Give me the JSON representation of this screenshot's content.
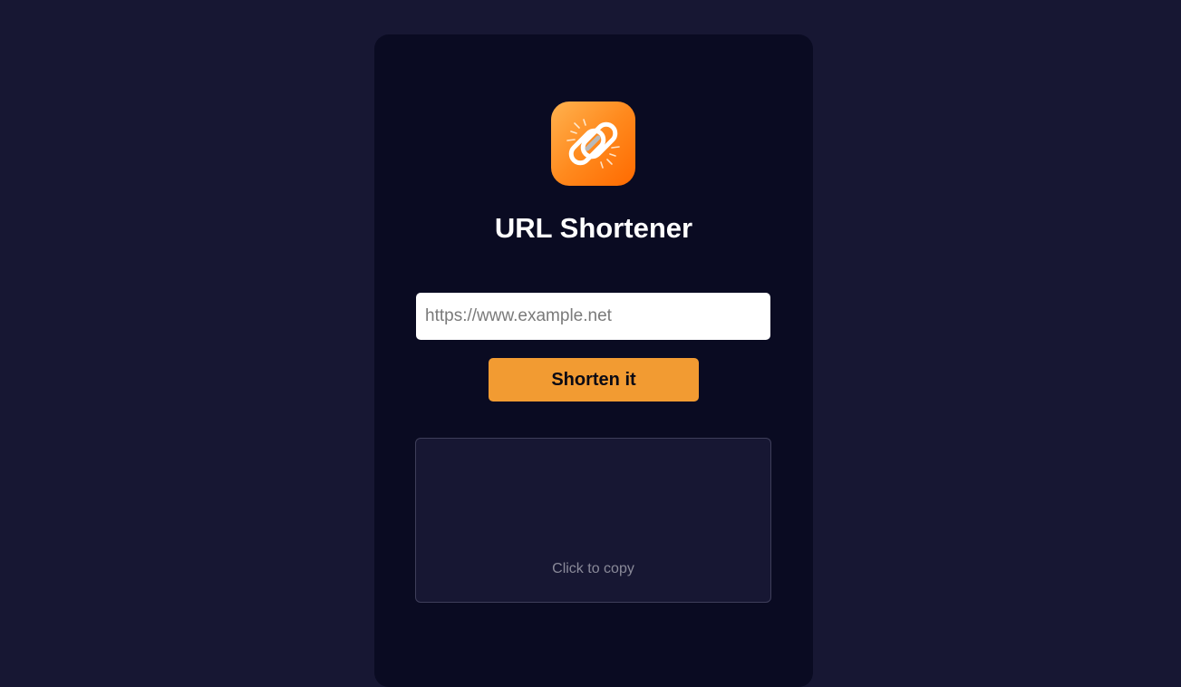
{
  "app": {
    "title": "URL Shortener",
    "logo_icon": "broken-link-icon",
    "accent_color": "#f29b32",
    "background_color": "#171733",
    "card_color": "#0a0b22"
  },
  "form": {
    "url_placeholder": "https://www.example.net",
    "url_value": "",
    "submit_label": "Shorten it"
  },
  "result": {
    "short_url": "",
    "copy_hint": "Click to copy"
  }
}
